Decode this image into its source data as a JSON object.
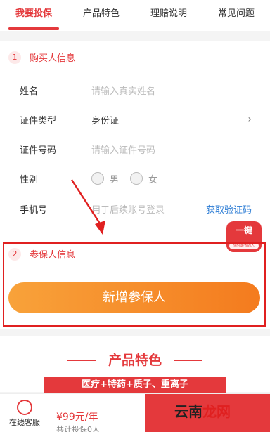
{
  "tabs": [
    "我要投保",
    "产品特色",
    "理赔说明",
    "常见问题"
  ],
  "buyer_section": {
    "num": "1",
    "title": "购买人信息"
  },
  "fields": {
    "name": {
      "label": "姓名",
      "placeholder": "请输入真实姓名"
    },
    "id_type": {
      "label": "证件类型",
      "value": "身份证"
    },
    "id_number": {
      "label": "证件号码",
      "placeholder": "请输入证件号码"
    },
    "gender": {
      "label": "性别",
      "male": "男",
      "female": "女"
    },
    "phone": {
      "label": "手机号",
      "placeholder": "用于后续账号登录",
      "get_code": "获取验证码"
    }
  },
  "badge": {
    "line1": "一键",
    "line2": "保你最省的人"
  },
  "insured_section": {
    "num": "2",
    "title": "参保人信息"
  },
  "add_button": "新增参保人",
  "features": {
    "title": "产品特色",
    "banner": "医疗+特药+质子、重离子"
  },
  "bottom": {
    "service": "在线客服",
    "price": "¥99元/年",
    "count": "共计投保0人"
  },
  "watermark": {
    "a": "云南",
    "b": "龙网"
  },
  "colors": {
    "accent": "#e4393c",
    "button": "#f47b1e",
    "link": "#2a7bd4"
  }
}
